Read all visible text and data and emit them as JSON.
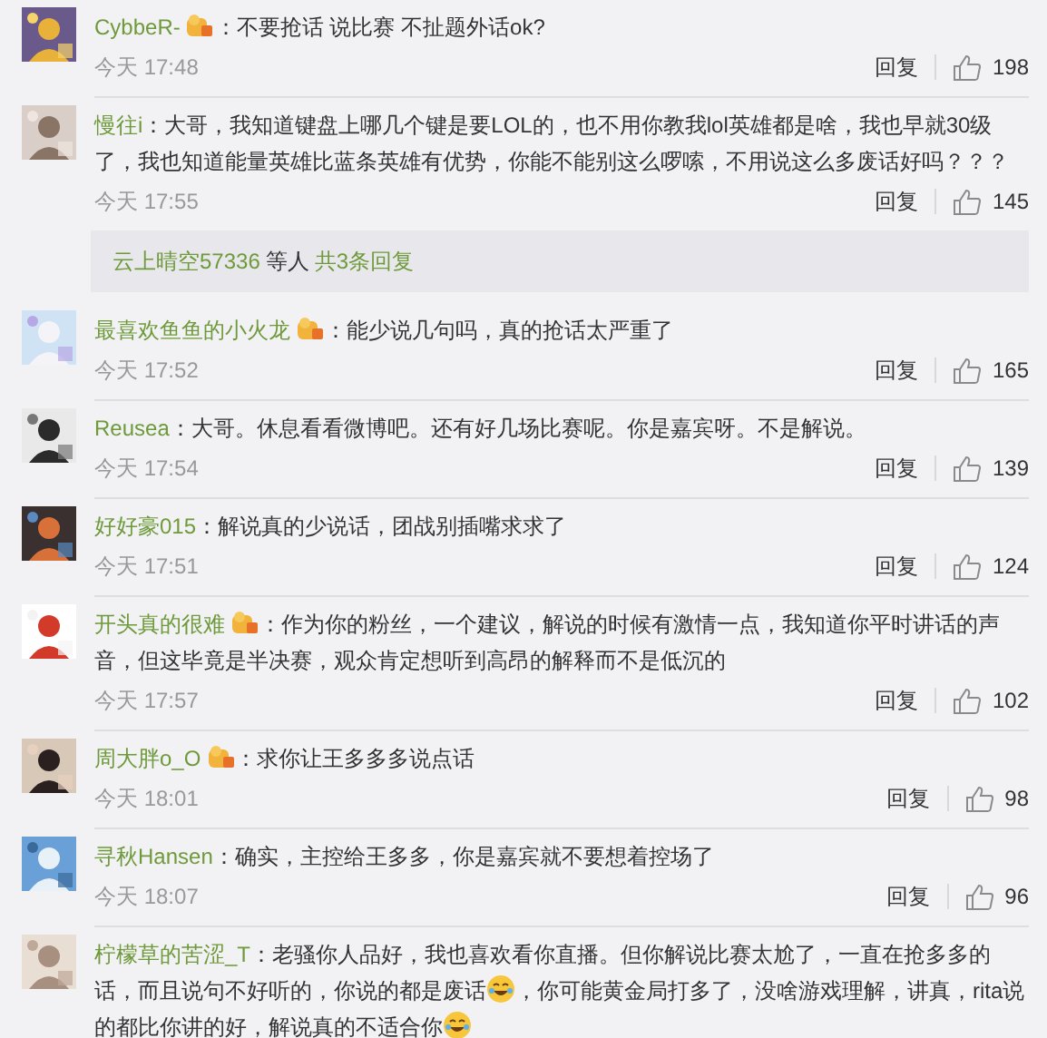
{
  "comments": [
    {
      "name": "CybbeR-",
      "badge": true,
      "content": [
        {
          "kind": "text",
          "text": "：不要抢话 说比赛 不扯题外话ok?"
        }
      ],
      "time": "今天 17:48",
      "reply": "回复",
      "likes": "198"
    },
    {
      "name": "慢往i",
      "badge": false,
      "content": [
        {
          "kind": "text",
          "text": "：大哥，我知道键盘上哪几个键是要LOL的，也不用你教我lol英雄都是啥，我也早就30级了，我也知道能量英雄比蓝条英雄有优势，你能不能别这么啰嗦，不用说这么多废话好吗？？？"
        }
      ],
      "time": "今天 17:55",
      "reply": "回复",
      "likes": "145",
      "replies": {
        "user": "云上晴空57336",
        "middle": "等人",
        "count": "共3条回复"
      }
    },
    {
      "name": "最喜欢鱼鱼的小火龙",
      "badge": true,
      "content": [
        {
          "kind": "text",
          "text": "：能少说几句吗，真的抢话太严重了"
        }
      ],
      "time": "今天 17:52",
      "reply": "回复",
      "likes": "165"
    },
    {
      "name": "Reusea",
      "badge": false,
      "content": [
        {
          "kind": "text",
          "text": "：大哥。休息看看微博吧。还有好几场比赛呢。你是嘉宾呀。不是解说。"
        }
      ],
      "time": "今天 17:54",
      "reply": "回复",
      "likes": "139"
    },
    {
      "name": "好好豪015",
      "badge": false,
      "content": [
        {
          "kind": "text",
          "text": "：解说真的少说话，团战别插嘴求求了"
        }
      ],
      "time": "今天 17:51",
      "reply": "回复",
      "likes": "124"
    },
    {
      "name": "开头真的很难",
      "badge": true,
      "content": [
        {
          "kind": "text",
          "text": "：作为你的粉丝，一个建议，解说的时候有激情一点，我知道你平时讲话的声音，但这毕竟是半决赛，观众肯定想听到高昂的解释而不是低沉的"
        }
      ],
      "time": "今天 17:57",
      "reply": "回复",
      "likes": "102"
    },
    {
      "name": "周大胖o_O",
      "badge": true,
      "content": [
        {
          "kind": "text",
          "text": "：求你让王多多多说点话"
        }
      ],
      "time": "今天 18:01",
      "reply": "回复",
      "likes": "98"
    },
    {
      "name": "寻秋Hansen",
      "badge": false,
      "content": [
        {
          "kind": "text",
          "text": "：确实，主控给王多多，你是嘉宾就不要想着控场了"
        }
      ],
      "time": "今天 18:07",
      "reply": "回复",
      "likes": "96"
    },
    {
      "name": "柠檬草的苦涩_T",
      "badge": false,
      "content": [
        {
          "kind": "text",
          "text": "：老骚你人品好，我也喜欢看你直播。但你解说比赛太尬了，一直在抢多多的话，而且说句不好听的，你说的都是废话"
        },
        {
          "kind": "emoji"
        },
        {
          "kind": "text",
          "text": "，你可能黄金局打多了，没啥游戏理解，讲真，rita说的都比你讲的好，解说真的不适合你"
        },
        {
          "kind": "emoji"
        }
      ]
    }
  ]
}
